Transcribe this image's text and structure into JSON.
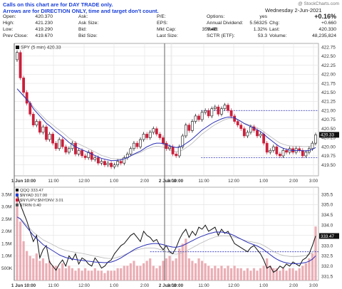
{
  "notes": {
    "line1": "Calls on this chart are for DAY TRADE only.",
    "line2": "Arrows are for DIRECTION ONLY, time and target don't count."
  },
  "watermark": "@ StockCharts.com",
  "quote": {
    "date": "Wednesday  2-Jun-2021",
    "rows": [
      [
        {
          "label": "Open:",
          "value": "420.370"
        },
        {
          "label": "Ask:",
          "value": ""
        },
        {
          "label": "P/E:",
          "value": ""
        },
        {
          "label": "Options:",
          "value": "yes"
        }
      ],
      [
        {
          "label": "High:",
          "value": "421.230"
        },
        {
          "label": "Ask Size:",
          "value": ""
        },
        {
          "label": "EPS:",
          "value": ""
        },
        {
          "label": "Annual Dividend:",
          "value": "5.56325"
        }
      ],
      [
        {
          "label": "Low:",
          "value": "419.290"
        },
        {
          "label": "Bid:",
          "value": ""
        },
        {
          "label": "Mkt Cap:",
          "value": "359.4B"
        },
        {
          "label": "Yield:",
          "value": "1.32%"
        }
      ],
      [
        {
          "label": "Prev Close:",
          "value": "419.670"
        },
        {
          "label": "Bid Size:",
          "value": ""
        },
        {
          "label": "Last Size:",
          "value": ""
        },
        {
          "label": "SCTR (ETF):",
          "value": "53.3"
        }
      ]
    ],
    "right": [
      {
        "label": "",
        "value": "+0.16%"
      },
      {
        "label": "Chg:",
        "value": "+0.660"
      },
      {
        "label": "Last:",
        "value": "420.330"
      },
      {
        "label": "Volume:",
        "value": "48,235,824"
      }
    ]
  },
  "colors": {
    "up": "#111111",
    "down": "#cc1f3a",
    "ma": "#2b2fb5",
    "ma2": "#b8b8b8",
    "ref": "#2b2fb5",
    "volume": "#e8a0a8"
  },
  "chart_data": [
    {
      "type": "candlestick",
      "title": "SPY (5 min) 420.33",
      "ylim": [
        419.2,
        422.85
      ],
      "yticks": [
        "419.50",
        "419.75",
        "420.00",
        "420.25",
        "420.50",
        "420.75",
        "421.00",
        "421.25",
        "421.50",
        "421.75",
        "422.00",
        "422.25",
        "422.50",
        "422.75"
      ],
      "xticks": [
        "1 Jun",
        "10:00",
        "11:00",
        "12:00",
        "1:00",
        "2:00",
        "3:00",
        "2 Jun",
        "10:00",
        "11:00",
        "12:00",
        "1:00",
        "2:00",
        "3:00"
      ],
      "xtick_labels": [
        "1 Jun 10:00",
        "11:00",
        "12:00",
        "1:00",
        "2:00",
        "3:00",
        "2 Jun 10:00",
        "11:00",
        "12:00",
        "1:00",
        "2:00",
        "3:00"
      ],
      "close": [
        422.6,
        421.9,
        421.5,
        421.2,
        420.9,
        420.6,
        420.7,
        420.4,
        420.55,
        420.2,
        420.35,
        420.1,
        419.95,
        420.2,
        420.0,
        419.85,
        419.95,
        420.1,
        419.8,
        419.9,
        419.75,
        419.7,
        419.85,
        419.65,
        419.7,
        419.55,
        419.6,
        419.5,
        419.55,
        419.45,
        419.5,
        419.6,
        419.55,
        419.7,
        419.8,
        419.95,
        420.1,
        420.0,
        420.2,
        420.35,
        420.25,
        420.4,
        420.5,
        420.35,
        420.25,
        420.1,
        419.95,
        420.0,
        419.8,
        419.75,
        420.0,
        420.3,
        420.6,
        420.45,
        420.7,
        420.85,
        420.75,
        420.95,
        421.0,
        420.85,
        421.05,
        421.1,
        420.9,
        421.05,
        421.15,
        421.0,
        420.85,
        420.7,
        420.6,
        420.5,
        420.3,
        420.4,
        420.55,
        420.45,
        420.3,
        420.35,
        420.1,
        419.85,
        419.9,
        420.0,
        419.8,
        419.75,
        419.9,
        419.85,
        419.95,
        419.85,
        419.95,
        419.9,
        419.75,
        419.85,
        419.95,
        420.1,
        420.33
      ],
      "ma_values": [
        421.6,
        421.5,
        421.4,
        421.3,
        421.2,
        421.05,
        420.95,
        420.85,
        420.75,
        420.65,
        420.58,
        420.5,
        420.42,
        420.35,
        420.28,
        420.2,
        420.12,
        420.06,
        420.0,
        419.96,
        419.92,
        419.88,
        419.84,
        419.8,
        419.76,
        419.72,
        419.68,
        419.66,
        419.64,
        419.62,
        419.62,
        419.63,
        419.64,
        419.67,
        419.7,
        419.75,
        419.8,
        419.84,
        419.88,
        419.94,
        420.0,
        420.04,
        420.08,
        420.1,
        420.1,
        420.09,
        420.06,
        420.03,
        420.0,
        419.98,
        419.99,
        420.03,
        420.09,
        420.15,
        420.22,
        420.3,
        420.38,
        420.46,
        420.52,
        420.58,
        420.64,
        420.69,
        420.73,
        420.77,
        420.8,
        420.82,
        420.82,
        420.8,
        420.75,
        420.7,
        420.64,
        420.6,
        420.56,
        420.52,
        420.47,
        420.42,
        420.35,
        420.27,
        420.2,
        420.13,
        420.06,
        420.0,
        419.96,
        419.93,
        419.91,
        419.9,
        419.9,
        419.9,
        419.89,
        419.89,
        419.9,
        419.93,
        419.98
      ],
      "ref_lines": [
        {
          "y": 421.0
        },
        {
          "y": 419.7
        }
      ],
      "last_value": "420.33"
    },
    {
      "type": "line",
      "title": "QQQ 333.47",
      "legend": [
        "$NYAD 317.00",
        "$NYUPV:$NYDNV 3.01",
        "$TRIN 0.40"
      ],
      "ylim": [
        331.3,
        335.85
      ],
      "yticks_right": [
        "331.5",
        "332.0",
        "332.5",
        "333.0",
        "333.5",
        "334.0",
        "334.5",
        "335.0",
        "335.5"
      ],
      "yticks_left": [
        "500K",
        "1.0M",
        "1.5M",
        "2.0M",
        "2.5M",
        "3.0M",
        "3.5M"
      ],
      "values": [
        335.5,
        335.0,
        334.6,
        334.2,
        333.7,
        333.2,
        333.5,
        332.4,
        332.8,
        333.0,
        332.2,
        332.0,
        331.8,
        332.1,
        332.3,
        332.0,
        332.5,
        332.3,
        332.6,
        332.1,
        332.4,
        332.3,
        332.1,
        332.0,
        332.4,
        332.2,
        331.9,
        332.0,
        332.2,
        332.3,
        332.6,
        332.8,
        333.0,
        333.1,
        333.3,
        333.5,
        333.6,
        333.4,
        333.2,
        333.7,
        333.5,
        333.4,
        333.2,
        333.3,
        333.0,
        332.8,
        333.0,
        332.7,
        332.6,
        332.9,
        333.3,
        333.6,
        333.8,
        333.4,
        333.7,
        333.5,
        333.9,
        333.8,
        334.0,
        333.7,
        333.8,
        333.9,
        333.5,
        333.8,
        333.6,
        333.7,
        333.4,
        333.1,
        333.0,
        332.9,
        332.8,
        332.7,
        332.9,
        333.0,
        332.8,
        332.6,
        332.3,
        331.9,
        332.0,
        331.7,
        331.8,
        332.0,
        331.9,
        332.1,
        332.0,
        332.2,
        332.1,
        332.0,
        332.3,
        332.4,
        332.6,
        333.0,
        333.47
      ],
      "ma_values": [
        334.4,
        334.3,
        334.1,
        333.9,
        333.7,
        333.5,
        333.35,
        333.2,
        333.05,
        332.95,
        332.85,
        332.75,
        332.65,
        332.55,
        332.48,
        332.42,
        332.38,
        332.35,
        332.32,
        332.3,
        332.28,
        332.26,
        332.24,
        332.22,
        332.2,
        332.19,
        332.18,
        332.17,
        332.18,
        332.2,
        332.25,
        332.32,
        332.4,
        332.5,
        332.6,
        332.7,
        332.8,
        332.88,
        332.94,
        333.0,
        333.05,
        333.08,
        333.1,
        333.1,
        333.08,
        333.05,
        333.0,
        332.96,
        332.93,
        332.92,
        332.95,
        333.0,
        333.08,
        333.16,
        333.24,
        333.32,
        333.4,
        333.46,
        333.52,
        333.58,
        333.62,
        333.66,
        333.66,
        333.66,
        333.64,
        333.6,
        333.55,
        333.48,
        333.4,
        333.32,
        333.24,
        333.16,
        333.1,
        333.04,
        332.98,
        332.9,
        332.8,
        332.68,
        332.56,
        332.44,
        332.34,
        332.26,
        332.2,
        332.16,
        332.13,
        332.12,
        332.12,
        332.13,
        332.15,
        332.18,
        332.24,
        332.34,
        332.5
      ],
      "volume_millions": [
        3.6,
        2.4,
        1.6,
        1.2,
        1.0,
        0.9,
        1.1,
        0.8,
        0.9,
        0.7,
        0.8,
        0.6,
        0.6,
        0.5,
        0.7,
        0.5,
        0.6,
        0.5,
        0.4,
        0.5,
        0.4,
        0.5,
        0.4,
        0.4,
        0.5,
        0.4,
        0.4,
        0.3,
        0.4,
        0.4,
        0.4,
        0.5,
        0.5,
        0.6,
        0.6,
        0.7,
        0.8,
        0.6,
        0.6,
        0.7,
        0.8,
        0.9,
        0.6,
        0.5,
        0.6,
        0.8,
        0.9,
        1.0,
        0.8,
        0.9,
        1.3,
        1.5,
        1.7,
        0.9,
        0.8,
        0.7,
        0.9,
        0.8,
        0.7,
        0.6,
        0.5,
        0.6,
        0.5,
        0.6,
        0.5,
        0.6,
        0.5,
        0.6,
        0.5,
        0.5,
        0.4,
        0.5,
        0.4,
        0.5,
        0.4,
        0.5,
        0.6,
        0.9,
        0.6,
        0.5,
        0.5,
        0.4,
        0.5,
        0.4,
        0.5,
        0.5,
        0.4,
        0.5,
        0.6,
        0.7,
        0.9,
        1.1,
        2.2
      ],
      "ref_lines": [
        {
          "y": 332.7
        }
      ],
      "last_value": "333.47"
    }
  ]
}
